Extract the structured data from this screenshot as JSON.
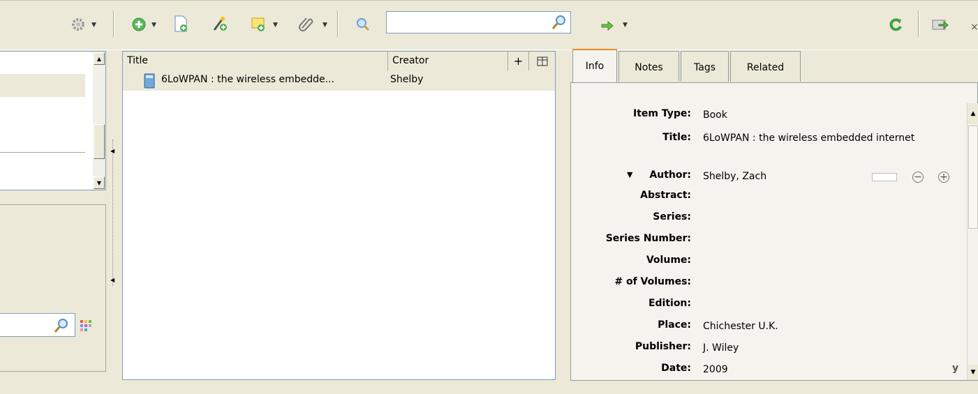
{
  "toolbar": {
    "search": {
      "value": "",
      "placeholder": ""
    },
    "icons": [
      "gear-icon",
      "new-item-icon",
      "new-note-icon",
      "add-by-identifier-icon",
      "new-standalone-note-icon",
      "attachment-icon",
      "advanced-search-icon",
      "search-magnifier-icon",
      "locate-arrow-icon",
      "sync-icon",
      "fullscreen-icon"
    ],
    "close_glyph": "×"
  },
  "items": {
    "columns": [
      {
        "label": "Title"
      },
      {
        "label": "Creator"
      }
    ],
    "add_column_glyph": "+",
    "rows": [
      {
        "title": "6LoWPAN : the wireless embedde...",
        "creator": "Shelby"
      }
    ]
  },
  "item_pane": {
    "tabs": [
      {
        "label": "Info",
        "active": true
      },
      {
        "label": "Notes"
      },
      {
        "label": "Tags"
      },
      {
        "label": "Related"
      }
    ],
    "fields": [
      {
        "label": "Item Type:",
        "value": "Book"
      },
      {
        "label": "Title:",
        "value": "6LoWPAN : the wireless embedded internet"
      },
      {
        "label": "Author:",
        "value": "Shelby, Zach"
      },
      {
        "label": "Abstract:",
        "value": ""
      },
      {
        "label": "Series:",
        "value": ""
      },
      {
        "label": "Series Number:",
        "value": ""
      },
      {
        "label": "Volume:",
        "value": ""
      },
      {
        "label": "# of Volumes:",
        "value": ""
      },
      {
        "label": "Edition:",
        "value": ""
      },
      {
        "label": "Place:",
        "value": "Chichester U.K."
      },
      {
        "label": "Publisher:",
        "value": "J. Wiley"
      },
      {
        "label": "Date:",
        "value": "2009"
      }
    ],
    "date_suffix": "y",
    "author_remove_glyph": "−",
    "author_add_glyph": "+"
  },
  "colors": {
    "background": "#ece9d8",
    "tab_accent": "#e68b2c",
    "selection": "#ece9d8"
  }
}
